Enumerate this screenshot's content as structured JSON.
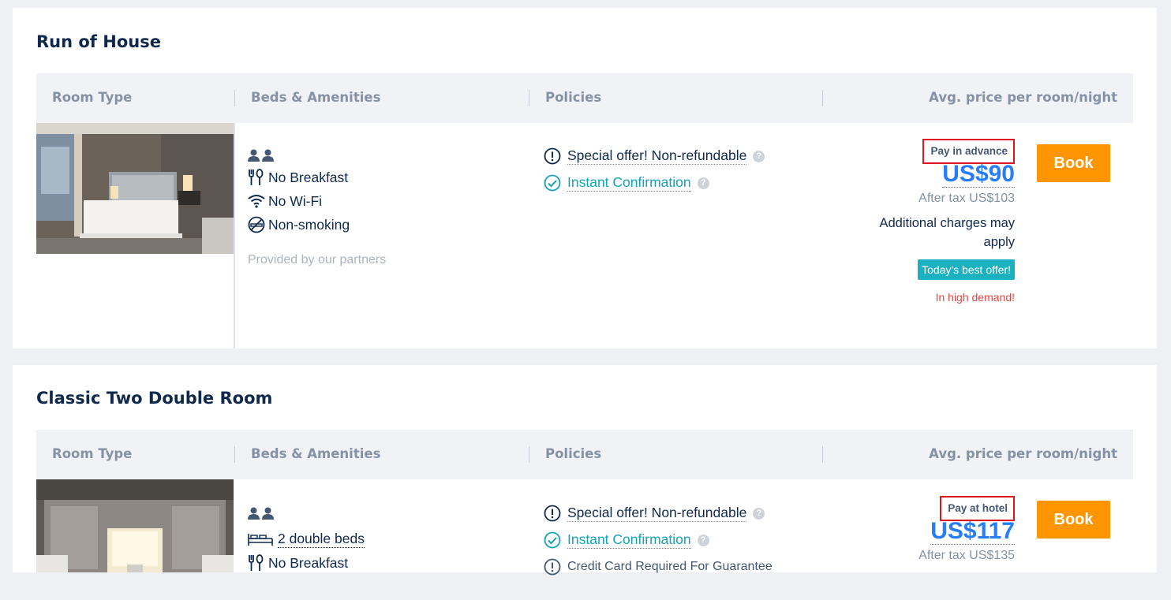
{
  "rooms": [
    {
      "title": "Run of House",
      "headers": [
        "Room Type",
        "Beds & Amenities",
        "Policies",
        "Avg. price per room/night"
      ],
      "amenities": [
        "No Breakfast",
        "No Wi-Fi",
        "Non-smoking"
      ],
      "partners_note": "Provided by our partners",
      "policies": [
        "Special offer! Non-refundable",
        "Instant Confirmation"
      ],
      "payment_type": "Pay in advance",
      "price": "US$90",
      "after_tax": "After tax US$103",
      "additional_charges": "Additional charges may apply",
      "best_offer": "Today's best offer!",
      "demand": "In high demand!",
      "book_label": "Book"
    },
    {
      "title": "Classic Two Double Room",
      "headers": [
        "Room Type",
        "Beds & Amenities",
        "Policies",
        "Avg. price per room/night"
      ],
      "beds": "2 double beds",
      "amenities": [
        "No Breakfast"
      ],
      "policies": [
        "Special offer! Non-refundable",
        "Instant Confirmation",
        "Credit Card Required For Guarantee"
      ],
      "payment_type": "Pay at hotel",
      "price": "US$117",
      "after_tax": "After tax US$135",
      "book_label": "Book"
    }
  ],
  "icons": {
    "guests": "person-icon",
    "meal": "cutlery-icon",
    "wifi": "wifi-icon",
    "smoking": "no-smoking-icon",
    "bed": "bed-icon",
    "notice": "exclamation-circle-icon",
    "confirm": "check-circle-icon",
    "help": "question-icon"
  },
  "colors": {
    "navy": "#0f294d",
    "price_blue": "#287dfa",
    "book_orange": "#ff9500",
    "teal": "#14a3b8",
    "badge_red": "#e0141e",
    "demand_red": "#e5453e"
  }
}
